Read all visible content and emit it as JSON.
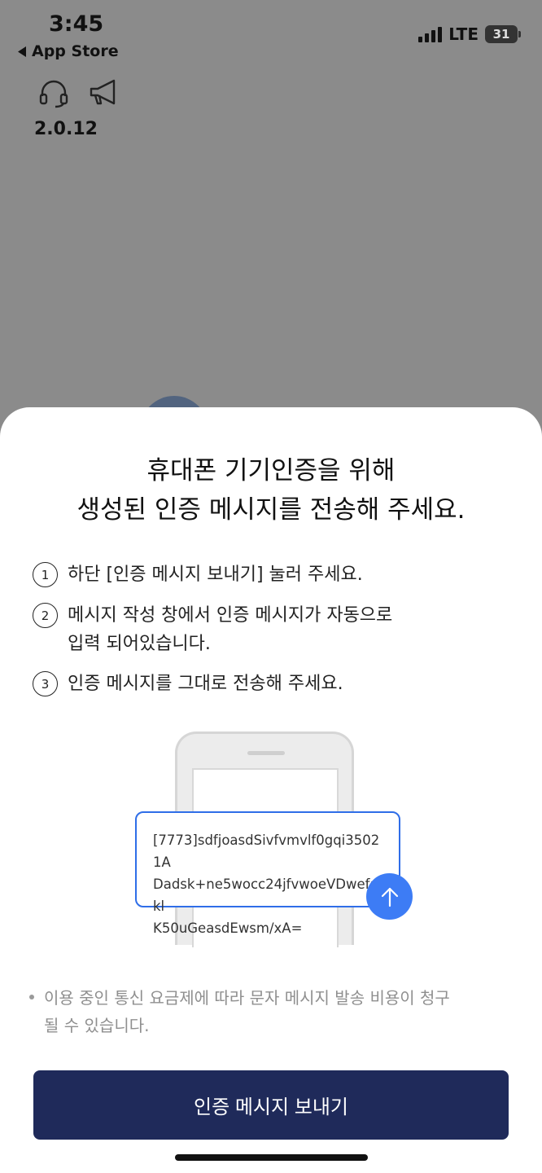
{
  "status_bar": {
    "time": "3:45",
    "back_label": "App Store",
    "network": "LTE",
    "battery": "31"
  },
  "header": {
    "icons": [
      "headset-icon",
      "megaphone-icon"
    ],
    "version": "2.0.12"
  },
  "sheet": {
    "title_line1": "휴대폰 기기인증을 위해",
    "title_line2": "생성된 인증 메시지를 전송해 주세요.",
    "steps": [
      {
        "num": "1",
        "lines": [
          "하단 [인증 메시지 보내기] 눌러 주세요."
        ]
      },
      {
        "num": "2",
        "lines": [
          "메시지 작성 창에서 인증 메시지가 자동으로",
          "입력 되어있습니다."
        ]
      },
      {
        "num": "3",
        "lines": [
          "인증 메시지를 그대로 전송해 주세요."
        ]
      }
    ],
    "message_lines": [
      "[7773]sdfjoasdSivfvmvlf0gqi35021A",
      "Dadsk+ne5wocc24jfvwoeVDwefakl",
      "K50uGeasdEwsm/xA="
    ],
    "notice_lines": [
      "이용 중인 통신 요금제에 따라 문자 메시지 발송 비용이 청구",
      "될 수 있습니다."
    ],
    "cta_label": "인증 메시지 보내기"
  },
  "colors": {
    "accent_blue": "#3d7cf5",
    "cta_navy": "#1f2a5a",
    "overlay_gray": "#8b8b8b"
  }
}
